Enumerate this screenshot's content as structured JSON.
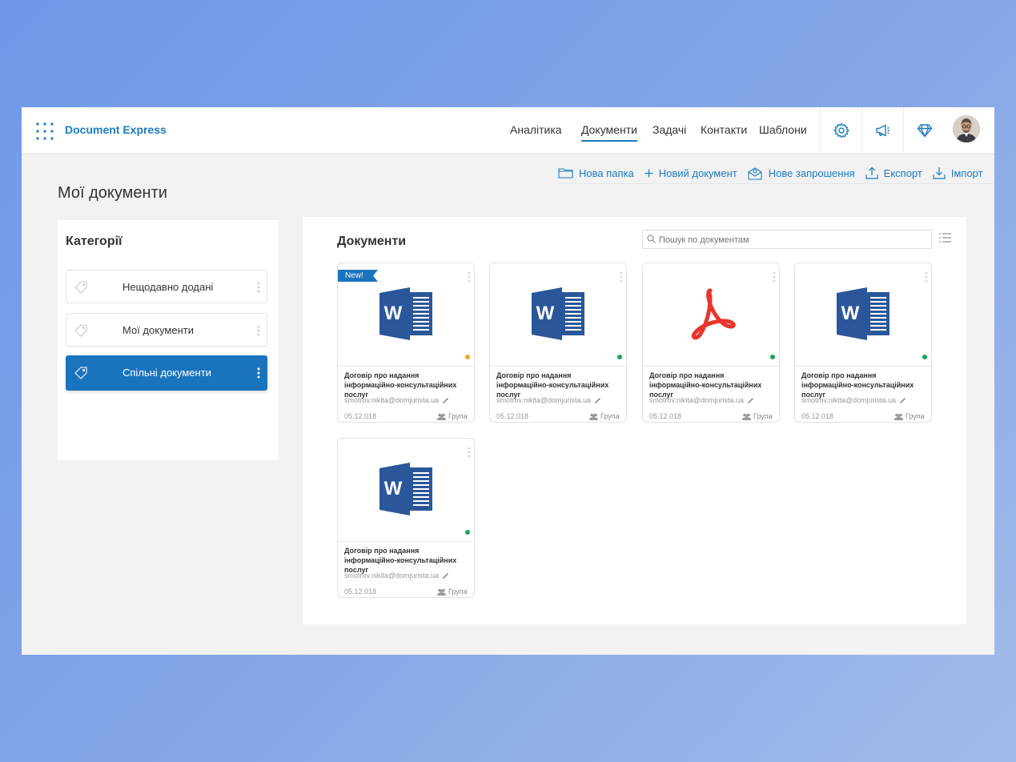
{
  "app": {
    "title": "Document Express"
  },
  "nav": [
    {
      "label": "Аналітика"
    },
    {
      "label": "Документи",
      "active": true
    },
    {
      "label": "Задачі"
    },
    {
      "label": "Контакти"
    },
    {
      "label": "Шаблони"
    }
  ],
  "tools": {
    "icons": [
      "gear-icon",
      "megaphone-icon",
      "diamond-icon"
    ]
  },
  "actions": {
    "new_folder": "Нова папка",
    "new_document": "Новий документ",
    "new_invite": "Нове запрошення",
    "export": "Експорт",
    "import": "Імпорт"
  },
  "page": {
    "title": "Мої документи"
  },
  "categories": {
    "title": "Категорії",
    "items": [
      {
        "label": "Нещодавно додані"
      },
      {
        "label": "Мої документи"
      },
      {
        "label": "Спільні документи",
        "active": true
      }
    ]
  },
  "documents": {
    "title": "Документи",
    "search_placeholder": "Пошук по документам",
    "items": [
      {
        "type": "word",
        "badge": "New!",
        "status": "#f0a81d",
        "title": "Договір про надання інформаційно-консультаційних послуг",
        "email": "smotrov.nikita@domjurista.ua",
        "date": "05.12.018",
        "group": "Група"
      },
      {
        "type": "word",
        "status": "#1aa65a",
        "title": "Договір про надання інформаційно-консультаційних послуг",
        "email": "smotrov.nikita@domjurista.ua",
        "date": "05.12.018",
        "group": "Група"
      },
      {
        "type": "pdf",
        "status": "#1aa65a",
        "title": "Договір про надання інформаційно-консультаційних послуг",
        "email": "smotrov.nikita@domjurista.ua",
        "date": "05.12.018",
        "group": "Група"
      },
      {
        "type": "word",
        "status": "#1aa65a",
        "title": "Договір про надання інформаційно-консультаційних послуг",
        "email": "smotrov.nikita@domjurista.ua",
        "date": "05.12.018",
        "group": "Група"
      },
      {
        "type": "word",
        "status": "#1aa65a",
        "title": "Договір про надання інформаційно-консультаційних послуг",
        "email": "smotrov.nikita@domjurista.ua",
        "date": "05.12.018",
        "group": "Група"
      }
    ]
  },
  "colors": {
    "accent": "#1a7cc1",
    "active_category": "#1a74bd",
    "word_blue": "#2b579a",
    "pdf_red": "#e8352b"
  }
}
